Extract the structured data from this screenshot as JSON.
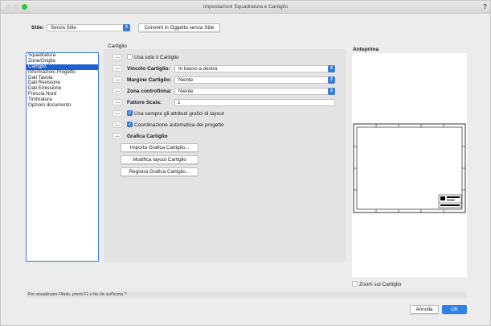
{
  "window": {
    "title": "Impostazioni Squadratura e Cartiglio",
    "help": "?"
  },
  "colors": {
    "accent": "#3a7bd5",
    "close": "#f2574e",
    "minimize": "#f8bb36",
    "zoom": "#2cc444"
  },
  "style_row": {
    "label": "Stile:",
    "value": "Senza Stile",
    "convert_button": "Converti in Oggetto senza Stile"
  },
  "sidebar": {
    "items": [
      {
        "label": "Squadratura",
        "selected": false
      },
      {
        "label": "Zone/Griglia",
        "selected": false
      },
      {
        "label": "Cartiglio",
        "selected": true
      },
      {
        "label": "Informazioni Progetto",
        "selected": false
      },
      {
        "label": "Dati Tavola",
        "selected": false
      },
      {
        "label": "Dati Revisione",
        "selected": false
      },
      {
        "label": "Dati Emissione",
        "selected": false
      },
      {
        "label": "Freccia Nord",
        "selected": false
      },
      {
        "label": "Timbratura",
        "selected": false
      },
      {
        "label": "Opzioni documento",
        "selected": false
      }
    ]
  },
  "cartiglio": {
    "section_title": "Cartiglio",
    "use_only_cartiglio": {
      "label": "Usa solo il Cartiglio",
      "checked": false
    },
    "vincolo": {
      "label": "Vincolo Cartiglio:",
      "value": "In basso a destra"
    },
    "margine": {
      "label": "Margine Cartiglio:",
      "value": "Niente"
    },
    "zona": {
      "label": "Zona controfirma:",
      "value": "Niente"
    },
    "fattore": {
      "label": "Fattore Scala:",
      "value": "1"
    },
    "use_graphic_attrs": {
      "label": "Usa sempre gli attributi grafici di layout",
      "checked": true
    },
    "auto_coord": {
      "label": "Coordinazione automatica dei progetto",
      "checked": true
    },
    "grafica_title": "Grafica Cartiglio",
    "buttons": {
      "importa": "Importa Grafica Cartiglio...",
      "modifica": "Modifica layout Cartiglio",
      "registra": "Registra Grafica Cartiglio..."
    }
  },
  "preview": {
    "title": "Anteprima",
    "zoom_label": "Zoom sul Cartiglio",
    "zoom_checked": false
  },
  "status": "Per visualizzare l'Aiuto, premi F1 o fai clic sull'icona ?",
  "footer": {
    "cancel": "Annulla",
    "ok": "OK"
  }
}
